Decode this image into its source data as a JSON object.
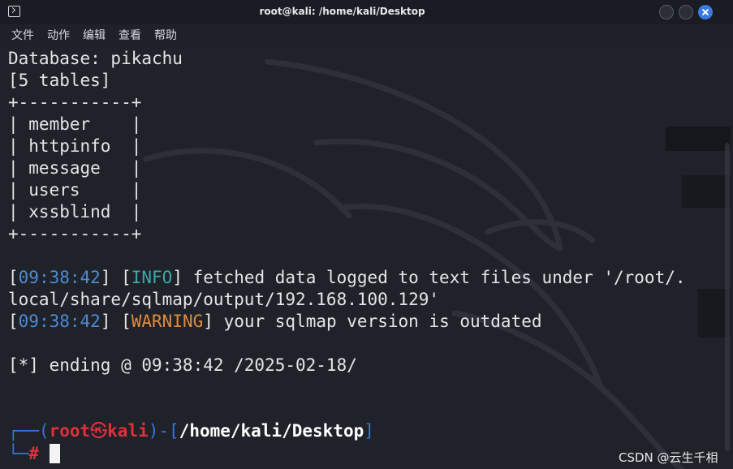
{
  "window": {
    "title": "root@kali: /home/kali/Desktop"
  },
  "menu": {
    "items": [
      "文件",
      "动作",
      "编辑",
      "查看",
      "帮助"
    ]
  },
  "terminal": {
    "lines": [
      "Database: pikachu",
      "[5 tables]",
      "+-----------+",
      "| member    |",
      "| httpinfo  |",
      "| message   |",
      "| users     |",
      "| xssblind  |",
      "+-----------+"
    ],
    "log1": {
      "time": "09:38:42",
      "level": "INFO",
      "message": " fetched data logged to text files under '/root/."
    },
    "log1_cont": "local/share/sqlmap/output/192.168.100.129'",
    "log2": {
      "time": "09:38:42",
      "level": "WARNING",
      "message": " your sqlmap version is outdated"
    },
    "ending": "[*] ending @ 09:38:42 /2025-02-18/",
    "prompt": {
      "user": "root",
      "host": "kali",
      "path": "/home/kali/Desktop",
      "symbol": "#"
    }
  },
  "colors": {
    "background": "#1f2229",
    "timestamp": "#4d8bd6",
    "info": "#3ca8a8",
    "warning": "#e08a3b",
    "prompt_red": "#e0303b",
    "prompt_blue": "#3a74d8",
    "close_button": "#3b7bdf"
  },
  "watermark": "CSDN @云生千相"
}
